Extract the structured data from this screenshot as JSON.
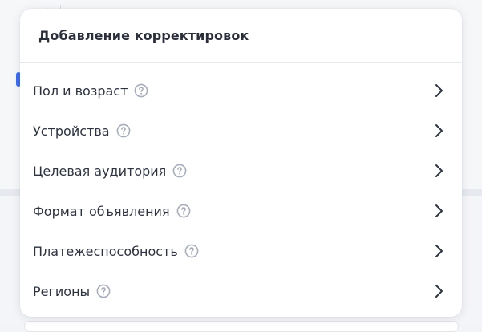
{
  "popover": {
    "title": "Добавление корректировок",
    "items": [
      {
        "label": "Пол и возраст",
        "help_icon": "question-circle-icon",
        "chevron_icon": "chevron-right-icon"
      },
      {
        "label": "Устройства",
        "help_icon": "question-circle-icon",
        "chevron_icon": "chevron-right-icon"
      },
      {
        "label": "Целевая аудитория",
        "help_icon": "question-circle-icon",
        "chevron_icon": "chevron-right-icon"
      },
      {
        "label": "Формат объявления",
        "help_icon": "question-circle-icon",
        "chevron_icon": "chevron-right-icon"
      },
      {
        "label": "Платежеспособность",
        "help_icon": "question-circle-icon",
        "chevron_icon": "chevron-right-icon"
      },
      {
        "label": "Регионы",
        "help_icon": "question-circle-icon",
        "chevron_icon": "chevron-right-icon"
      }
    ]
  },
  "colors": {
    "text": "#2e3340",
    "help_icon": "#a7adba",
    "chevron": "#2e3340",
    "background": "#eef0f4",
    "accent": "#3a6cf4"
  }
}
